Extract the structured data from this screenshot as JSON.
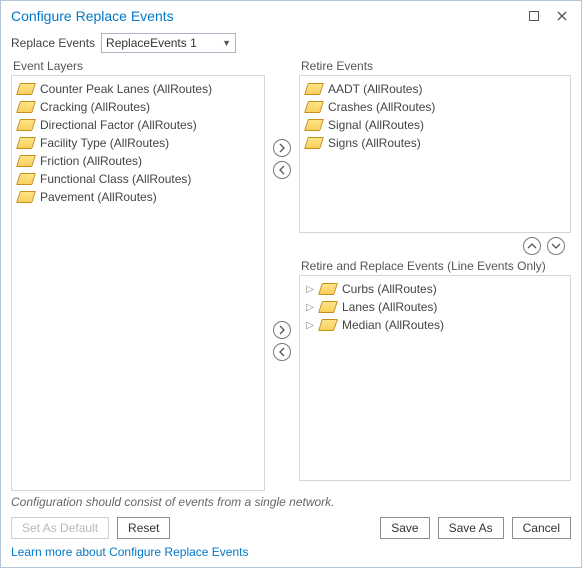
{
  "window": {
    "title": "Configure Replace Events"
  },
  "combo": {
    "label": "Replace Events",
    "value": "ReplaceEvents 1"
  },
  "sections": {
    "eventLayers": "Event Layers",
    "retireEvents": "Retire Events",
    "retireReplace": "Retire and Replace Events (Line Events Only)"
  },
  "eventLayers": [
    "Counter Peak Lanes (AllRoutes)",
    "Cracking (AllRoutes)",
    "Directional Factor (AllRoutes)",
    "Facility Type (AllRoutes)",
    "Friction (AllRoutes)",
    "Functional Class (AllRoutes)",
    "Pavement (AllRoutes)"
  ],
  "retireEvents": [
    "AADT (AllRoutes)",
    "Crashes (AllRoutes)",
    "Signal (AllRoutes)",
    "Signs (AllRoutes)"
  ],
  "retireReplace": [
    "Curbs (AllRoutes)",
    "Lanes (AllRoutes)",
    "Median (AllRoutes)"
  ],
  "hint": "Configuration should consist of events from a single network.",
  "buttons": {
    "setDefault": "Set As Default",
    "reset": "Reset",
    "save": "Save",
    "saveAs": "Save As",
    "cancel": "Cancel"
  },
  "link": "Learn more about Configure Replace Events"
}
